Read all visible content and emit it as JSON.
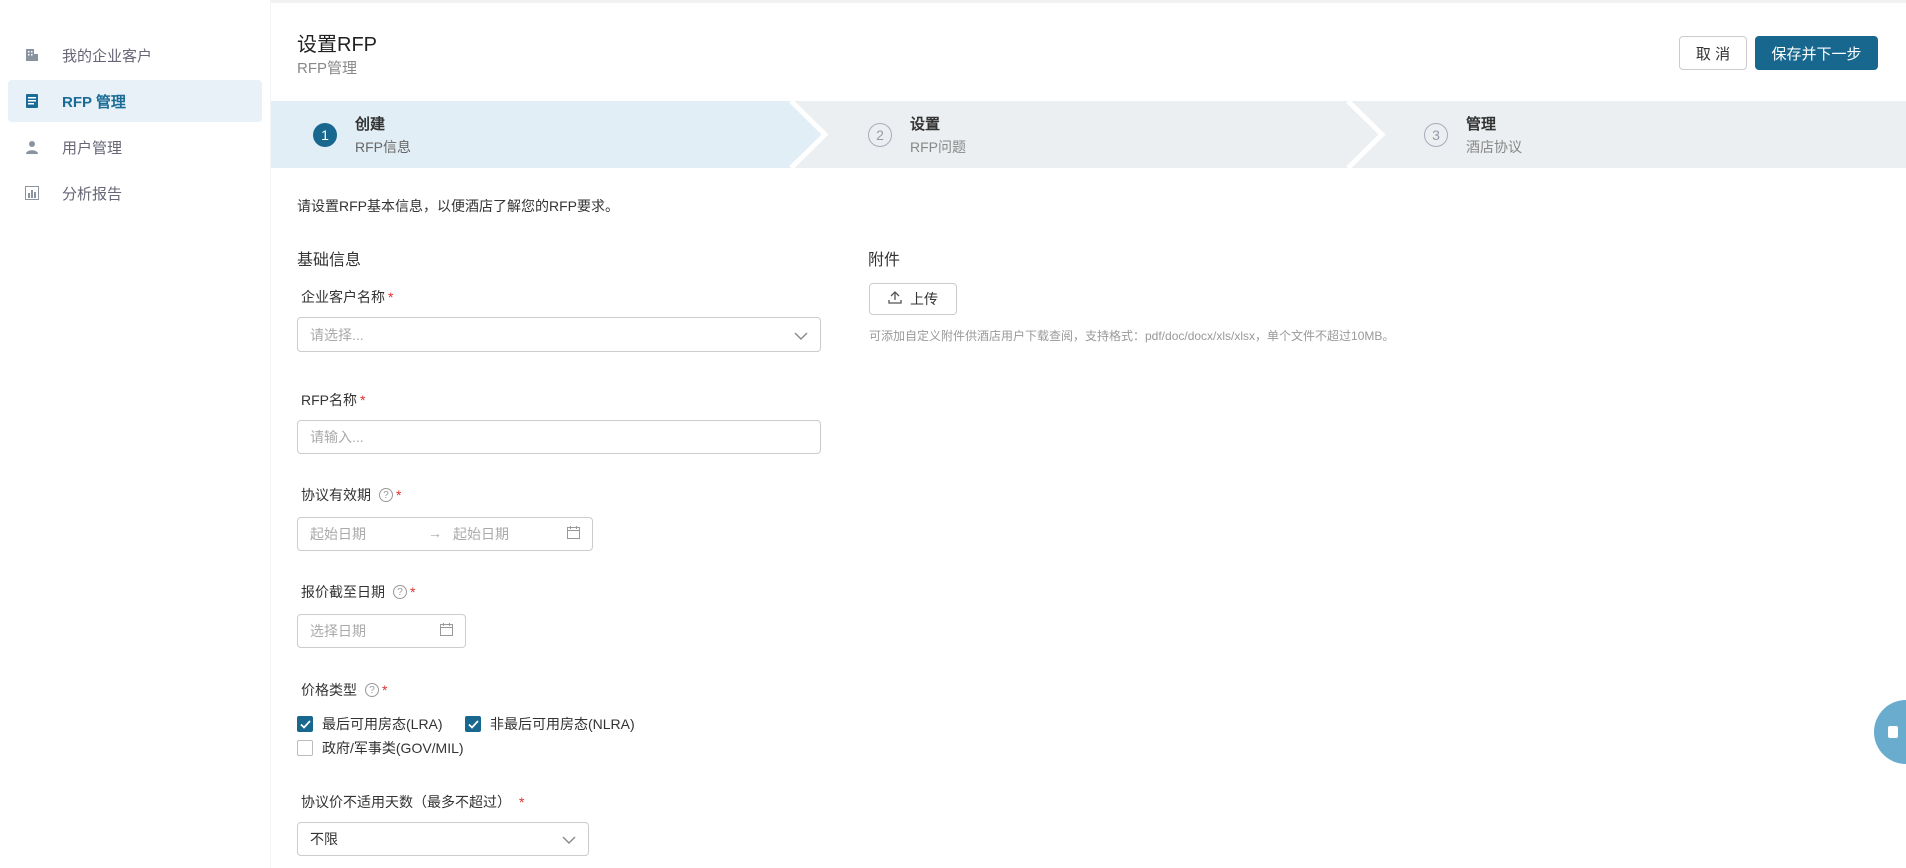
{
  "sidebar": {
    "items": [
      {
        "label": "我的企业客户",
        "icon": "building-icon",
        "active": false
      },
      {
        "label": "RFP 管理",
        "icon": "document-icon",
        "active": true
      },
      {
        "label": "用户管理",
        "icon": "user-icon",
        "active": false
      },
      {
        "label": "分析报告",
        "icon": "chart-icon",
        "active": false
      }
    ]
  },
  "header": {
    "title": "设置RFP",
    "subtitle": "RFP管理",
    "cancel_label": "取 消",
    "save_label": "保存并下一步"
  },
  "steps": [
    {
      "num": "1",
      "title": "创建",
      "sub": "RFP信息",
      "active": true
    },
    {
      "num": "2",
      "title": "设置",
      "sub": "RFP问题",
      "active": false
    },
    {
      "num": "3",
      "title": "管理",
      "sub": "酒店协议",
      "active": false
    }
  ],
  "form": {
    "intro": "请设置RFP基本信息，以便酒店了解您的RFP要求。",
    "basic_title": "基础信息",
    "attachment_title": "附件",
    "customer_label": "企业客户名称",
    "customer_placeholder": "请选择...",
    "rfp_name_label": "RFP名称",
    "rfp_name_placeholder": "请输入...",
    "validity_label": "协议有效期",
    "start_placeholder": "起始日期",
    "end_placeholder": "起始日期",
    "deadline_label": "报价截至日期",
    "deadline_placeholder": "选择日期",
    "price_type_label": "价格类型",
    "price_options": [
      {
        "label": "最后可用房态(LRA)",
        "checked": true
      },
      {
        "label": "非最后可用房态(NLRA)",
        "checked": true
      },
      {
        "label": "政府/军事类(GOV/MIL)",
        "checked": false
      }
    ],
    "blackout_label": "协议价不适用天数（最多不超过）",
    "blackout_value": "不限",
    "upload_label": "上传",
    "upload_hint": "可添加自定义附件供酒店用户下载查阅，支持格式：pdf/doc/docx/xls/xlsx，单个文件不超过10MB。",
    "required_mark": "*",
    "help_mark": "?"
  },
  "colors": {
    "primary": "#17678f",
    "active_nav_bg": "#e8f1f7",
    "required": "#e03030"
  }
}
